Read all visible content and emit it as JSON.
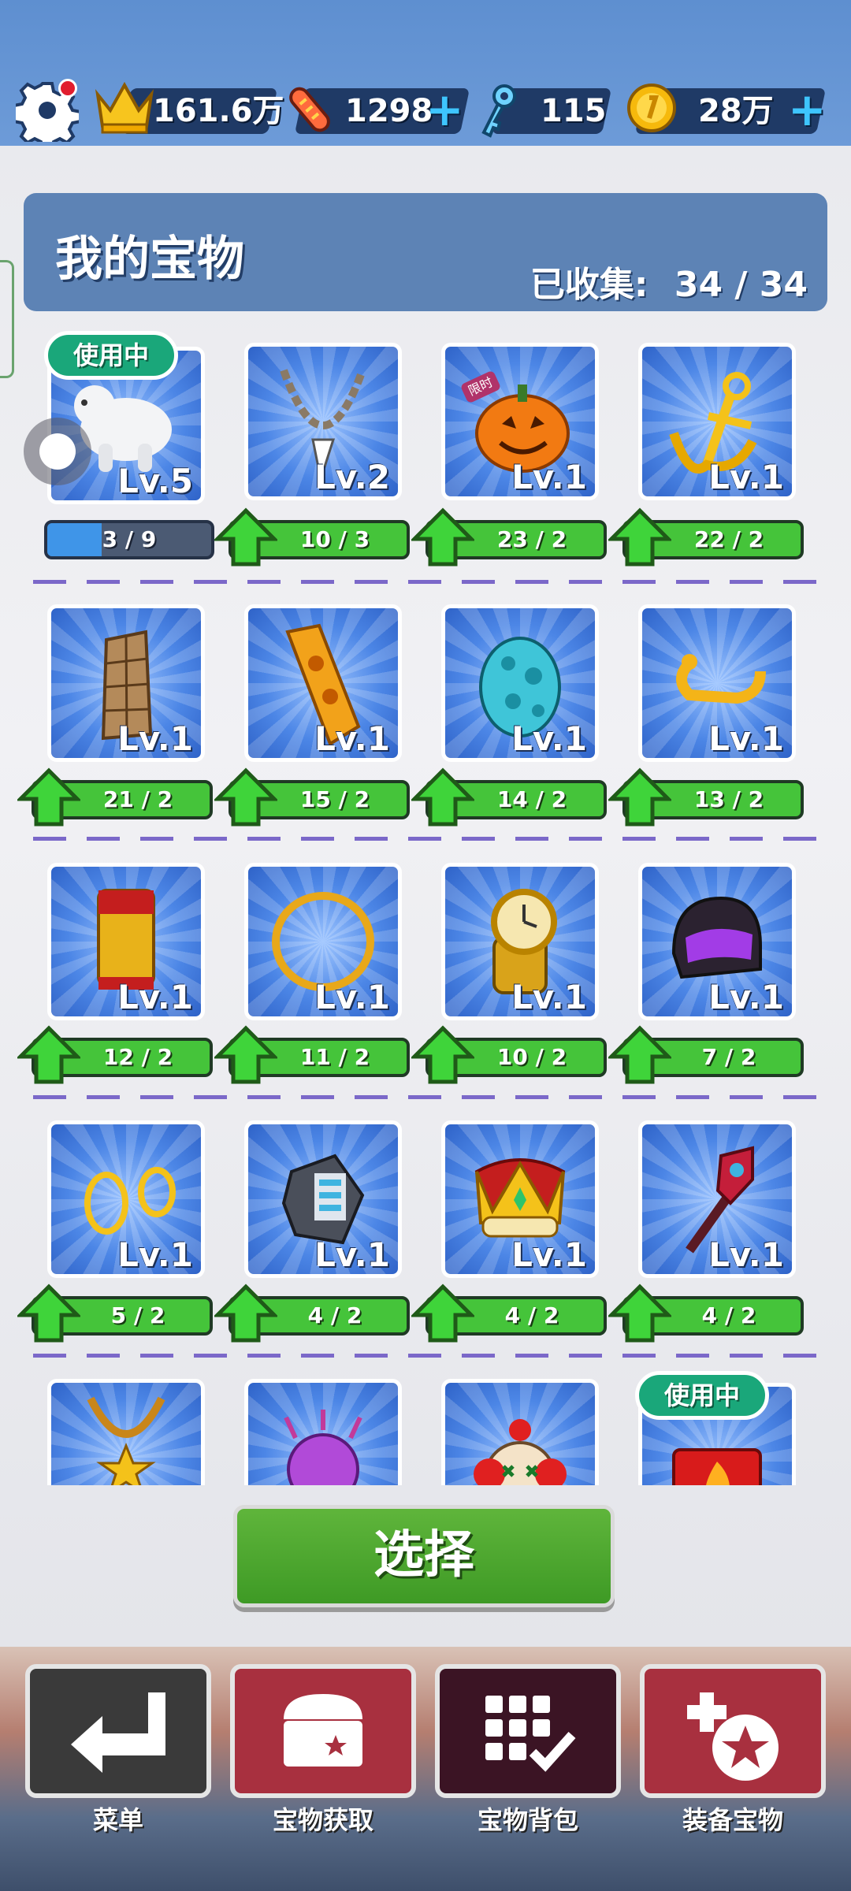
{
  "topbar": {
    "crowns": "161.6万",
    "boards": "1298",
    "keys": "115",
    "coins": "28万",
    "plus": "+"
  },
  "header": {
    "title": "我的宝物",
    "collected_label": "已收集:",
    "collected_value": "34 / 34"
  },
  "in_use_label": "使用中",
  "limited_label": "限时",
  "items": [
    {
      "name": "polar bear",
      "level": "Lv.5",
      "progress": "3 / 9",
      "progress_fraction": 0.33,
      "in_use": true
    },
    {
      "name": "tooth necklace",
      "level": "Lv.2",
      "bar": "10 / 3"
    },
    {
      "name": "pumpkin",
      "level": "Lv.1",
      "bar": "23 / 2",
      "limited": true
    },
    {
      "name": "anchor",
      "level": "Lv.1",
      "bar": "22 / 2"
    },
    {
      "name": "tower",
      "level": "Lv.1",
      "bar": "21 / 2"
    },
    {
      "name": "totem board",
      "level": "Lv.1",
      "bar": "15 / 2"
    },
    {
      "name": "spotted egg",
      "level": "Lv.1",
      "bar": "14 / 2"
    },
    {
      "name": "golden horns",
      "level": "Lv.1",
      "bar": "13 / 2"
    },
    {
      "name": "tiki drum",
      "level": "Lv.1",
      "bar": "12 / 2"
    },
    {
      "name": "golden ring",
      "level": "Lv.1",
      "bar": "11 / 2"
    },
    {
      "name": "gold watch",
      "level": "Lv.1",
      "bar": "10 / 2"
    },
    {
      "name": "purple helmet",
      "level": "Lv.1",
      "bar": "7 / 2"
    },
    {
      "name": "gold earrings",
      "level": "Lv.1",
      "bar": "5 / 2"
    },
    {
      "name": "robot gadget",
      "level": "Lv.1",
      "bar": "4 / 2"
    },
    {
      "name": "crown",
      "level": "Lv.1",
      "bar": "4 / 2"
    },
    {
      "name": "magic wand",
      "level": "Lv.1",
      "bar": "4 / 2"
    },
    {
      "name": "star necklace",
      "level": "",
      "bar": ""
    },
    {
      "name": "purple plant",
      "level": "",
      "bar": ""
    },
    {
      "name": "clown",
      "level": "",
      "bar": ""
    },
    {
      "name": "fire box",
      "level": "",
      "bar": "",
      "in_use": true
    }
  ],
  "select_button": "选择",
  "nav": [
    {
      "label": "菜单",
      "icon": "return-icon",
      "color": "#3a3a3a"
    },
    {
      "label": "宝物获取",
      "icon": "chest-icon",
      "color": "#a8303f"
    },
    {
      "label": "宝物背包",
      "icon": "grid-check-icon",
      "color": "#3b1424"
    },
    {
      "label": "装备宝物",
      "icon": "pot-star-icon",
      "color": "#a8303f"
    }
  ]
}
